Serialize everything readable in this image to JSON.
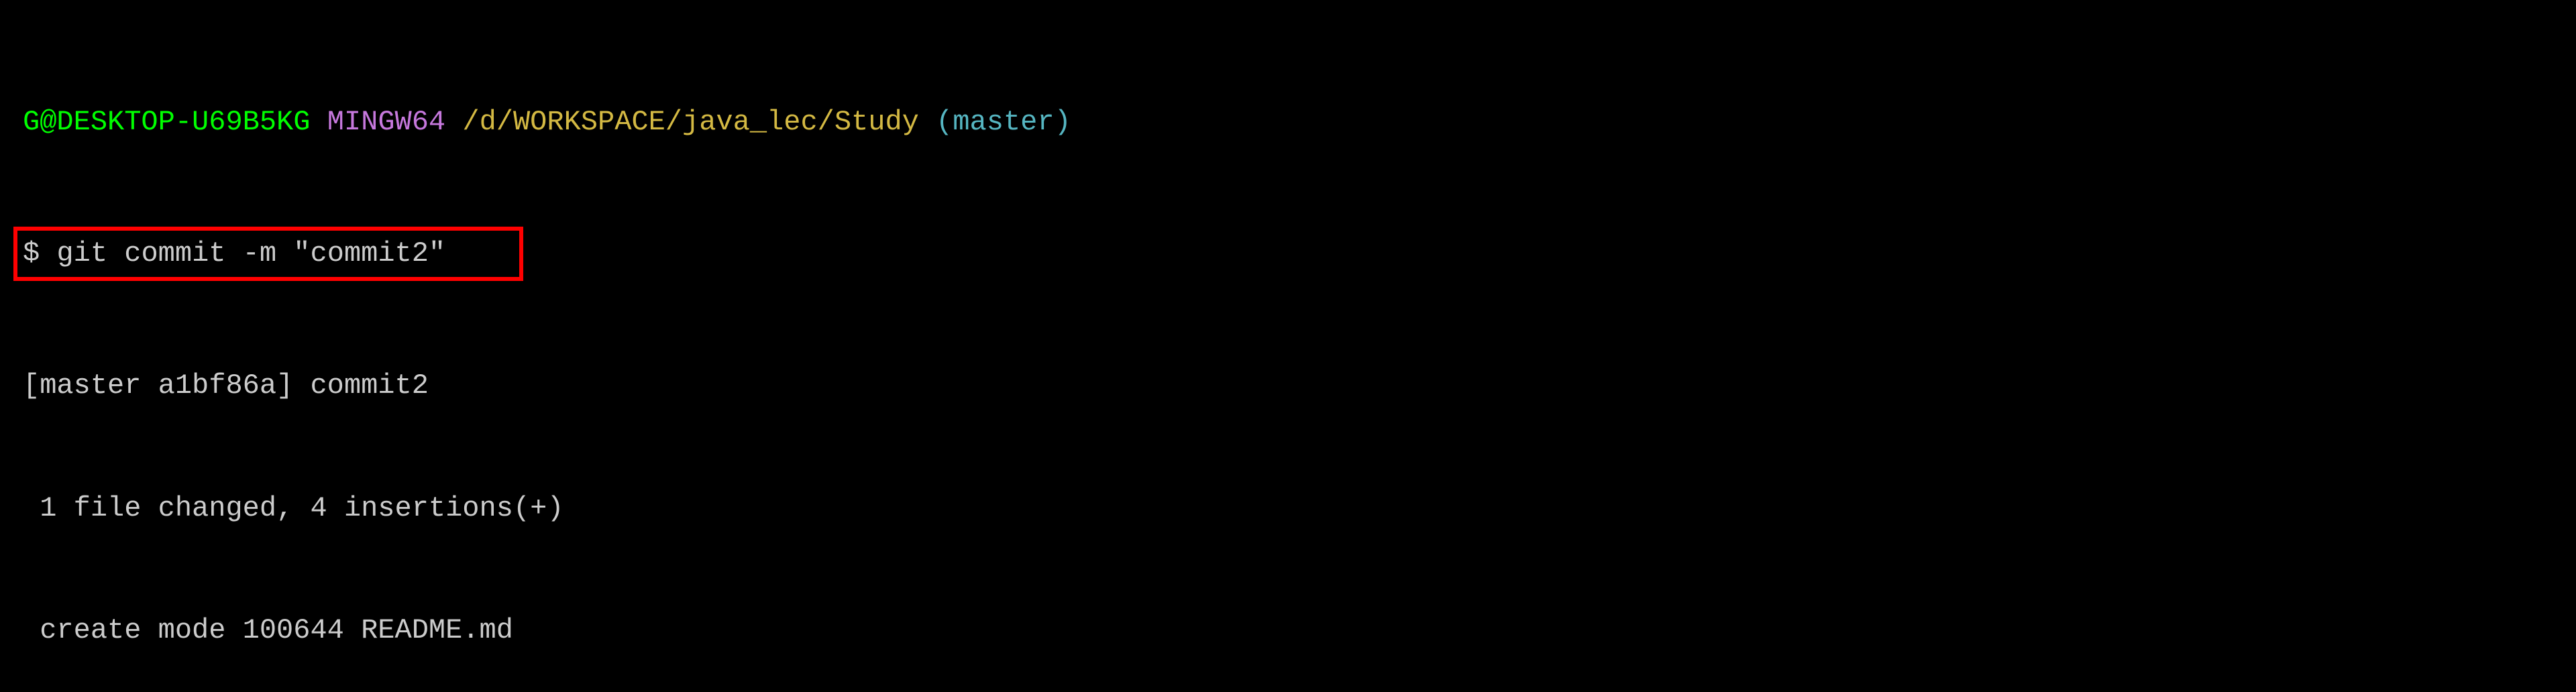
{
  "prompt": {
    "user_host": "G@DESKTOP-U69B5KG",
    "env": "MINGW64",
    "path": "/d/WORKSPACE/java_lec/Study",
    "branch": "(master)"
  },
  "command": {
    "symbol": "$",
    "text": "git commit -m \"commit2\""
  },
  "output": {
    "line1": "[master a1bf86a] commit2",
    "line2": " 1 file changed, 4 insertions(+)",
    "line3": " create mode 100644 README.md"
  },
  "highlight": {
    "color": "#ff0000"
  }
}
